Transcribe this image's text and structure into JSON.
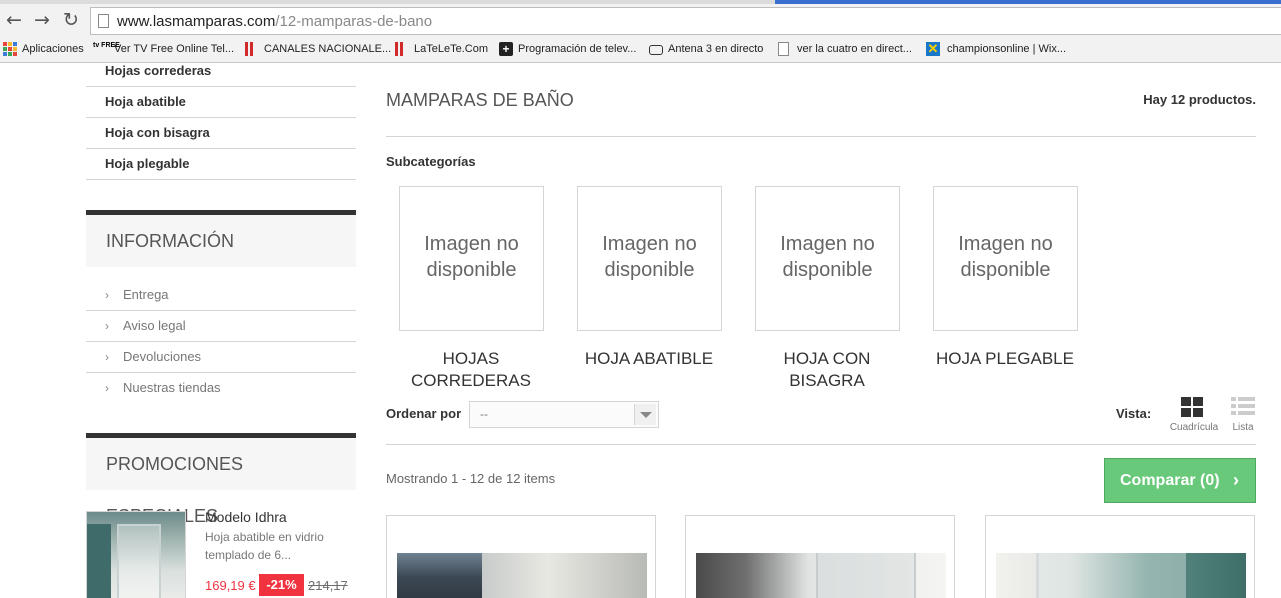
{
  "browser": {
    "url_host": "www.lasmamparas.com",
    "url_path": "/12-mamparas-de-bano",
    "bookmarks": [
      {
        "label": "Aplicaciones",
        "icon": "apps-grid-icon"
      },
      {
        "label": "Ver TV Free Online Tel...",
        "icon": "tv-free-icon",
        "icon_text": "tv FREE"
      },
      {
        "label": "CANALES NACIONALE...",
        "icon": "red-bars-icon"
      },
      {
        "label": "LaTeLeTe.Com",
        "icon": "red-bars-icon"
      },
      {
        "label": "Programación de telev...",
        "icon": "plus-cross-icon"
      },
      {
        "label": "Antena 3 en directo",
        "icon": "tv-antenna-icon"
      },
      {
        "label": "ver la cuatro en direct...",
        "icon": "document-icon"
      },
      {
        "label": "championsonline | Wix...",
        "icon": "wix-x-icon"
      }
    ]
  },
  "sidebar": {
    "categories": [
      "Hojas correderas",
      "Hoja abatible",
      "Hoja con bisagra",
      "Hoja plegable"
    ],
    "info": {
      "title": "INFORMACIÓN",
      "items": [
        "Entrega",
        "Aviso legal",
        "Devoluciones",
        "Nuestras tiendas"
      ]
    },
    "promos": {
      "title": "PROMOCIONES ESPECIALES",
      "item": {
        "name": "Modelo Idhra",
        "description": "Hoja abatible en vidrio templado de 6...",
        "price": "169,19 €",
        "discount": "-21%",
        "old_price": "214,17"
      }
    }
  },
  "main": {
    "heading": "MAMPARAS DE BAÑO",
    "product_count": "Hay 12 productos.",
    "subcategories_title": "Subcategorías",
    "subcategories": [
      {
        "image_text": "Imagen no disponible",
        "name": "HOJAS CORREDERAS"
      },
      {
        "image_text": "Imagen no disponible",
        "name": "HOJA ABATIBLE"
      },
      {
        "image_text": "Imagen no disponible",
        "name": "HOJA CON BISAGRA"
      },
      {
        "image_text": "Imagen no disponible",
        "name": "HOJA PLEGABLE"
      }
    ],
    "sort_label": "Ordenar por",
    "sort_value": "--",
    "view_label": "Vista:",
    "view_grid": "Cuadrícula",
    "view_list": "Lista",
    "showing": "Mostrando 1 - 12 de 12 items",
    "compare": "Comparar (0)"
  },
  "colors": {
    "accent_green": "#69c97b",
    "sale_red": "#f13340"
  }
}
